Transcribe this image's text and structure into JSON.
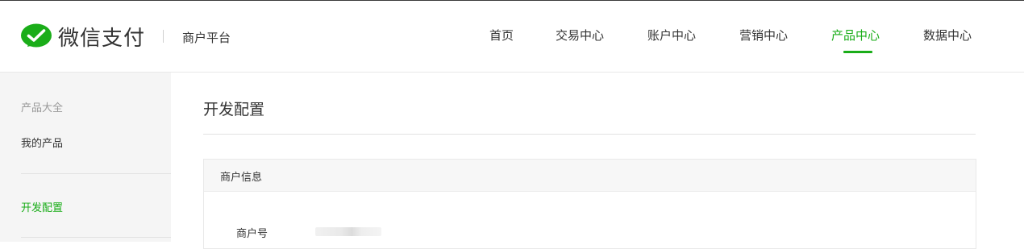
{
  "header": {
    "logo_text": "微信支付",
    "platform": "商户平台",
    "nav": [
      {
        "label": "首页",
        "active": false
      },
      {
        "label": "交易中心",
        "active": false
      },
      {
        "label": "账户中心",
        "active": false
      },
      {
        "label": "营销中心",
        "active": false
      },
      {
        "label": "产品中心",
        "active": true
      },
      {
        "label": "数据中心",
        "active": false
      }
    ]
  },
  "sidebar": {
    "group_label": "产品大全",
    "items": [
      {
        "label": "我的产品",
        "active": false
      },
      {
        "label": "开发配置",
        "active": true
      }
    ]
  },
  "main": {
    "title": "开发配置",
    "panel": {
      "heading": "商户信息",
      "fields": [
        {
          "label": "商户号",
          "value_obscured": true
        }
      ]
    }
  },
  "colors": {
    "accent": "#1aad19",
    "sidebar_bg": "#f5f5f5",
    "text": "#333333",
    "muted": "#999999"
  }
}
